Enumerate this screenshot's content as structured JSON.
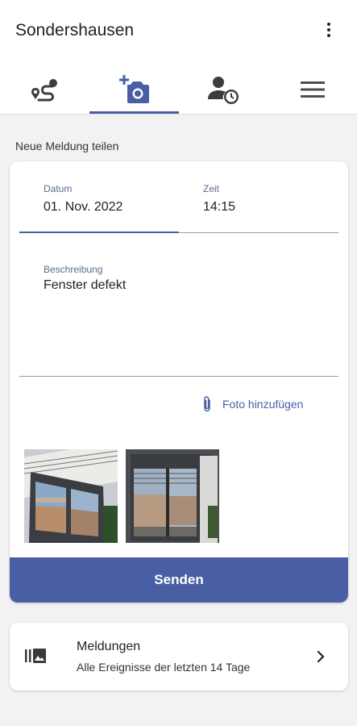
{
  "app": {
    "title": "Sondershausen"
  },
  "tabs": [
    {
      "name": "route",
      "icon": "route-icon"
    },
    {
      "name": "new-report",
      "icon": "add-photo-icon",
      "selected": true
    },
    {
      "name": "user-history",
      "icon": "user-clock-icon"
    },
    {
      "name": "menu",
      "icon": "menu-icon"
    }
  ],
  "form": {
    "section_title": "Neue Meldung teilen",
    "date_label": "Datum",
    "date_value": "01. Nov. 2022",
    "time_label": "Zeit",
    "time_value": "14:15",
    "description_label": "Beschreibung",
    "description_value": "Fenster defekt",
    "attach_label": "Foto hinzufügen",
    "photos": [
      "window-photo-1",
      "window-photo-2"
    ],
    "send_label": "Senden"
  },
  "reports": {
    "title": "Meldungen",
    "subtitle": "Alle Ereignisse der letzten 14 Tage",
    "icon": "photo-library-icon"
  },
  "colors": {
    "accent": "#4a5fa3",
    "background": "#f2f2f2",
    "card": "#ffffff"
  }
}
